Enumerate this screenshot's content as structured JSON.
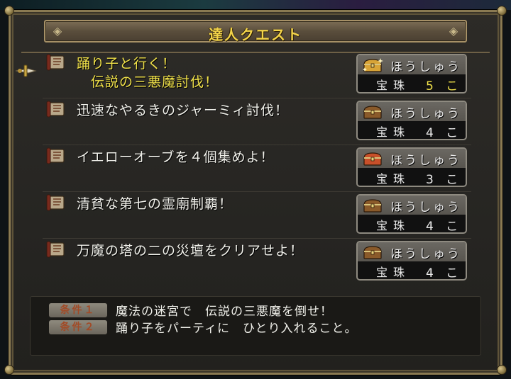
{
  "window": {
    "title": "達人クエスト"
  },
  "quests": [
    {
      "name": "踊り子と行く！\n　伝説の三悪魔討伐！",
      "selected": true,
      "reward_label": "ほうしゅう",
      "reward_item": "宝珠",
      "reward_count": "5 こ",
      "chest_color": "#d8a437",
      "chest_sparkle": true
    },
    {
      "name": "迅速なやるきのジャーミィ討伐！",
      "selected": false,
      "reward_label": "ほうしゅう",
      "reward_item": "宝珠",
      "reward_count": "4 こ",
      "chest_color": "#8a5a2a",
      "chest_sparkle": false
    },
    {
      "name": "イエローオーブを４個集めよ！",
      "selected": false,
      "reward_label": "ほうしゅう",
      "reward_item": "宝珠",
      "reward_count": "3 こ",
      "chest_color": "#c8502a",
      "chest_sparkle": false
    },
    {
      "name": "清貧な第七の霊廟制覇！",
      "selected": false,
      "reward_label": "ほうしゅう",
      "reward_item": "宝珠",
      "reward_count": "4 こ",
      "chest_color": "#8a5a2a",
      "chest_sparkle": false
    },
    {
      "name": "万魔の塔の二の災壇をクリアせよ！",
      "selected": false,
      "reward_label": "ほうしゅう",
      "reward_item": "宝珠",
      "reward_count": "4 こ",
      "chest_color": "#8a5a2a",
      "chest_sparkle": false
    }
  ],
  "conditions": [
    {
      "badge": "条件１",
      "text": "魔法の迷宮で　伝説の三悪魔を倒せ！"
    },
    {
      "badge": "条件２",
      "text": "踊り子をパーティに　ひとり入れること。"
    }
  ],
  "colors": {
    "title_gold": "#f3d44a",
    "selected_yellow": "#f1e24a",
    "frame_gold": "#8a7a52"
  },
  "icons": {
    "quest": "scroll-icon",
    "reward": "treasure-chest-icon",
    "cursor": "sword-cursor-icon"
  }
}
